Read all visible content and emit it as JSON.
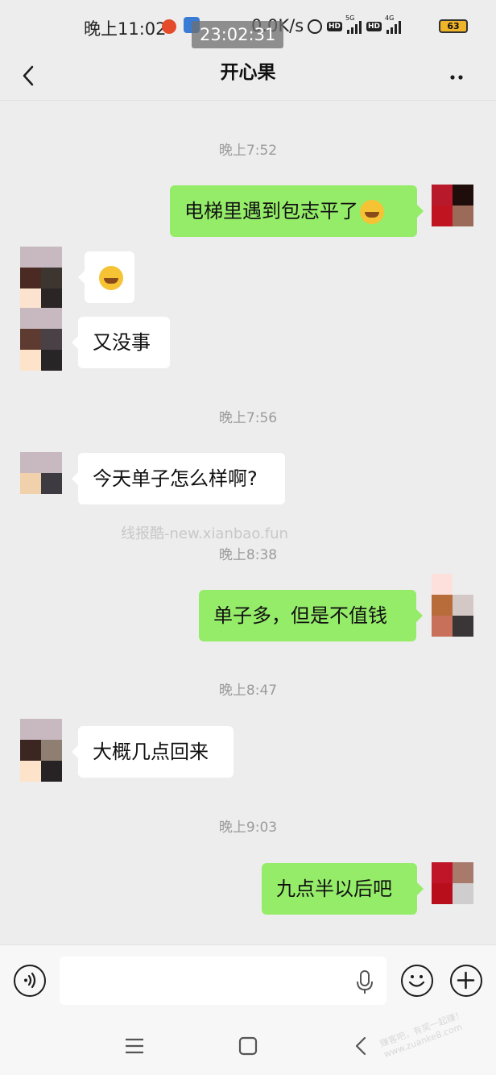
{
  "status_bar": {
    "time": "晚上11:02",
    "clock_overlay": "23:02:31",
    "net_speed": "0.0K/s",
    "sig1_label": "5G",
    "sig2_label": "4G",
    "hd_label": "HD",
    "battery": "63"
  },
  "header": {
    "title": "开心果"
  },
  "messages": [
    {
      "timestamp": "晚上7:52"
    },
    {
      "text": "电梯里遇到包志平了"
    },
    {
      "text": "又没事"
    },
    {
      "timestamp": "晚上7:56"
    },
    {
      "text": "今天单子怎么样啊?"
    },
    {
      "timestamp": "晚上8:38"
    },
    {
      "text": "单子多，但是不值钱"
    },
    {
      "timestamp": "晚上8:47"
    },
    {
      "text": "大概几点回来"
    },
    {
      "timestamp": "晚上9:03"
    },
    {
      "text": "九点半以后吧"
    }
  ],
  "watermark": "线报酷-new.xianbao.fun",
  "corner_stamp": "赚客吧，有奖一起赚！ www.zuanke8.com",
  "input": {
    "value": "",
    "placeholder": ""
  },
  "colors": {
    "outgoing_bubble": "#95ec69",
    "incoming_bubble": "#ffffff",
    "background": "#ededed"
  },
  "icons": [
    "back-icon",
    "more-icon",
    "voice-icon",
    "microphone-icon",
    "emoji-icon",
    "plus-icon",
    "menu-icon",
    "home-icon",
    "nav-back-icon"
  ]
}
